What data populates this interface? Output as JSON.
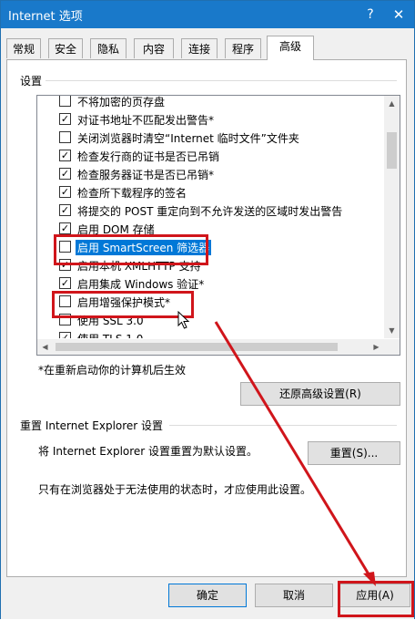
{
  "window": {
    "title": "Internet 选项",
    "help_label": "?",
    "close_label": "✕"
  },
  "tabs": [
    {
      "label": "常规"
    },
    {
      "label": "安全"
    },
    {
      "label": "隐私"
    },
    {
      "label": "内容"
    },
    {
      "label": "连接"
    },
    {
      "label": "程序"
    },
    {
      "label": "高级",
      "active": true
    }
  ],
  "settings": {
    "group_label": "设置",
    "items": [
      {
        "label": "不将加密的页存盘",
        "checked": false
      },
      {
        "label": "对证书地址不匹配发出警告*",
        "checked": true
      },
      {
        "label": "关闭浏览器时清空“Internet 临时文件”文件夹",
        "checked": false
      },
      {
        "label": "检查发行商的证书是否已吊销",
        "checked": true
      },
      {
        "label": "检查服务器证书是否已吊销*",
        "checked": true
      },
      {
        "label": "检查所下载程序的签名",
        "checked": true
      },
      {
        "label": "将提交的 POST 重定向到不允许发送的区域时发出警告",
        "checked": true
      },
      {
        "label": "启用 DOM 存储",
        "checked": true
      },
      {
        "label": "启用 SmartScreen 筛选器",
        "checked": false,
        "highlighted": true
      },
      {
        "label": "启用本机 XMLHTTP 支持",
        "checked": true
      },
      {
        "label": "启用集成 Windows 验证*",
        "checked": true
      },
      {
        "label": "启用增强保护模式*",
        "checked": false
      },
      {
        "label": "使用 SSL 3.0",
        "checked": false
      },
      {
        "label": "使用 TLS 1.0",
        "checked": true
      }
    ],
    "restart_note": "*在重新启动你的计算机后生效",
    "restore_button": "还原高级设置(R)"
  },
  "reset": {
    "group_label": "重置 Internet Explorer 设置",
    "description": "将 Internet Explorer 设置重置为默认设置。",
    "reset_button": "重置(S)...",
    "note": "只有在浏览器处于无法使用的状态时，才应使用此设置。"
  },
  "footer": {
    "ok_button": "确定",
    "cancel_button": "取消",
    "apply_button": "应用(A)"
  },
  "colors": {
    "titlebar": "#1979ca",
    "highlight": "#0078d7",
    "annotation": "#d0151b"
  }
}
